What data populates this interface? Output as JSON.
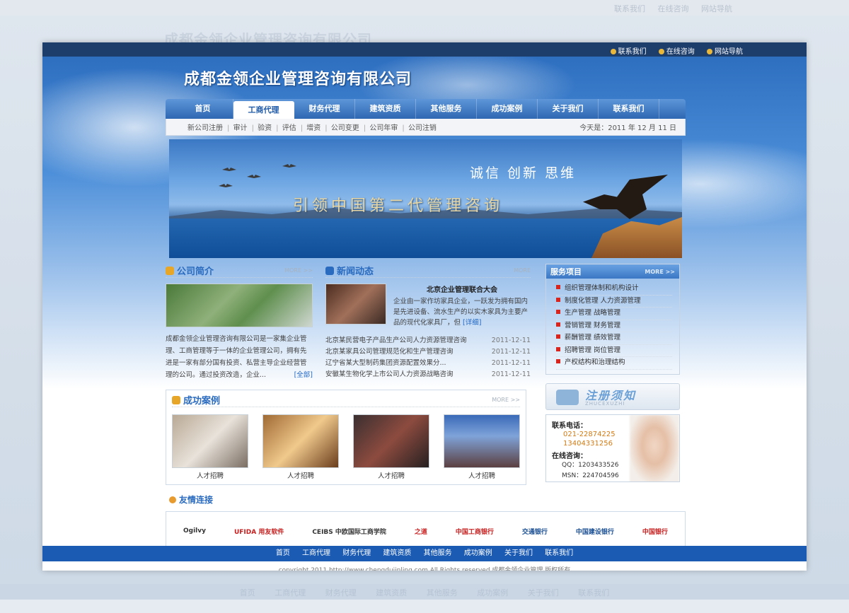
{
  "top_links": [
    "联系我们",
    "在线咨询",
    "网站导航"
  ],
  "company_name": "成都金领企业管理咨询有限公司",
  "nav": [
    "首页",
    "工商代理",
    "财务代理",
    "建筑资质",
    "其他服务",
    "成功案例",
    "关于我们",
    "联系我们"
  ],
  "nav_active": "工商代理",
  "subnav": [
    "新公司注册",
    "审计",
    "验资",
    "评估",
    "增资",
    "公司变更",
    "公司年审",
    "公司注销"
  ],
  "date_label": "今天是：2011 年 12 月 11 日",
  "banner": {
    "slogan1": "诚信 创新 思维",
    "slogan2": "引领中国第二代管理咨询"
  },
  "intro": {
    "title": "公司简介",
    "more": "MORE >>",
    "text": "成都金领企业管理咨询有限公司是一家集企业管理、工商管理等于一体的企业管理公司，拥有先进是一家有部分国有投资、私营主导企业经营管理的公司。通过投资改造，企业...",
    "all": "[全部]"
  },
  "news": {
    "title": "新闻动态",
    "more": "MORE",
    "feature_title": "北京企业管理联合大会",
    "feature_body": "企业由一家作坊家具企业，一跃发为拥有国内是先进设备、流水生产的以实木家具为主要产品的现代化家具厂，但",
    "detail": "[详细]",
    "items": [
      {
        "title": "北京某民营电子产品生产公司人力资源管理咨询",
        "date": "2011-12-11"
      },
      {
        "title": "北京某家具公司管理规范化和生产管理咨询",
        "date": "2011-12-11"
      },
      {
        "title": "辽宁省某大型制药集团资源配置效果分...",
        "date": "2011-12-11"
      },
      {
        "title": "安徽某生物化学上市公司人力资源战略咨询",
        "date": "2011-12-11"
      }
    ]
  },
  "cases": {
    "title": "成功案例",
    "more": "MORE >>",
    "items": [
      "人才招聘",
      "人才招聘",
      "人才招聘",
      "人才招聘"
    ]
  },
  "service": {
    "title": "服务项目",
    "more": "MORE >>",
    "items": [
      "组织管理体制和机构设计",
      "制度化管理 人力资源管理",
      "生产管理 战略管理",
      "营销管理 财务管理",
      "薪酬管理 绩效管理",
      "招聘管理 岗位管理",
      "产权结构和治理结构"
    ]
  },
  "register": {
    "title": "注册须知",
    "subtitle": "ZHUCEXUZHI"
  },
  "contact": {
    "phone_label": "联系电话：",
    "phones": [
      "021-22874225",
      "13404331256"
    ],
    "im_label": "在线咨询：",
    "qq": "QQ：1203433526",
    "msn": "MSN：224704596"
  },
  "friends": {
    "title": "友情连接",
    "partners": [
      "Ogilvy",
      "UFIDA 用友软件",
      "CEIBS 中欧国际工商学院",
      "之道",
      "中国工商银行",
      "交通银行",
      "中国建设银行",
      "中国银行"
    ]
  },
  "footer_nav": [
    "首页",
    "工商代理",
    "财务代理",
    "建筑资质",
    "其他服务",
    "成功案例",
    "关于我们",
    "联系我们"
  ],
  "copyright": "copyright 2011 http://www.chengdujinling.com All Rights reserved    成都金领企业管理 版权所有",
  "colors": {
    "nav_blue": "#2f68b2",
    "footer_blue": "#1b5bb4",
    "accent_red": "#d8261f",
    "topbar": "#1d3d6b"
  }
}
